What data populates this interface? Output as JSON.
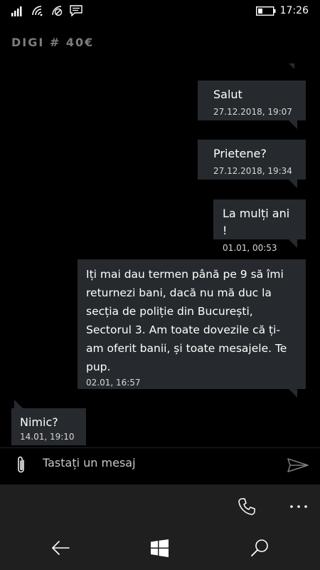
{
  "status_bar": {
    "time": "17:26",
    "icons": [
      "signal-icon",
      "wifi-icon",
      "data-saver-icon",
      "message-icon",
      "battery-icon"
    ]
  },
  "conversation": {
    "title": "DIGI # 40€"
  },
  "messages": [
    {
      "direction": "outgoing",
      "text": "Salut",
      "timestamp": "27.12.2018, 19:07"
    },
    {
      "direction": "outgoing",
      "text": "Prietene?",
      "timestamp": "27.12.2018, 19:34"
    },
    {
      "direction": "outgoing",
      "text": "La mulți ani !",
      "timestamp": "01.01, 00:53"
    },
    {
      "direction": "outgoing",
      "lines": [
        "Iți mai dau termen până pe 9 să îmi",
        "returnezi bani, dacă nu mă duc la",
        "secția de poliție din București,",
        "Sectorul 3. Am toate dovezile că ți-",
        "am oferit banii, și toate mesajele. Te",
        "pup."
      ],
      "timestamp": "02.01, 16:57"
    },
    {
      "direction": "incoming",
      "text": "Nimic?",
      "timestamp": "14.01, 19:10"
    }
  ],
  "composer": {
    "placeholder": "Tastați un mesaj",
    "attach_icon": "paperclip-icon",
    "send_icon": "send-icon"
  },
  "app_bar": {
    "icons": [
      "phone-icon",
      "more-icon"
    ]
  },
  "nav_bar": {
    "icons": [
      "back-icon",
      "windows-icon",
      "search-icon"
    ]
  },
  "colors": {
    "background": "#000000",
    "bubble": "#262a2e",
    "title": "#7b7d80",
    "bar": "#1f1f1f"
  }
}
